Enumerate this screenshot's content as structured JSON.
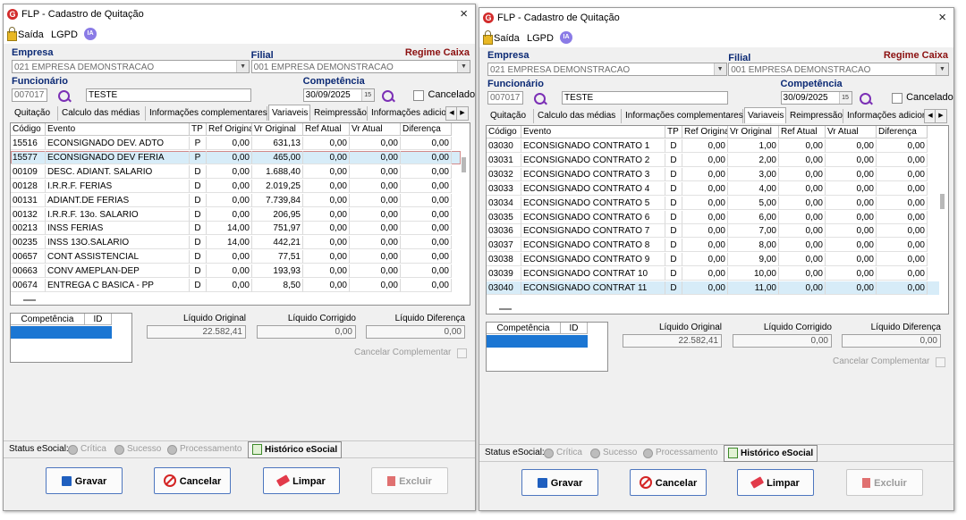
{
  "window": {
    "title": "FLP - Cadastro de Quitação",
    "close_glyph": "×",
    "logo_glyph": "G",
    "ia_label": "IA"
  },
  "menu": {
    "saida": "Saída",
    "lgpd": "LGPD"
  },
  "labels": {
    "empresa": "Empresa",
    "filial": "Filial",
    "regime": "Regime Caixa",
    "funcionario": "Funcionário",
    "competencia": "Competência",
    "cancelado": "Cancelado"
  },
  "tabs": [
    "Quitação",
    "Calculo das médias",
    "Informações complementares",
    "Variaveis",
    "Reimpressão",
    "Informações adicionais"
  ],
  "grid_headers": [
    "Código",
    "Evento",
    "TP",
    "Ref Original",
    "Vr Original",
    "Ref Atual",
    "Vr Atual",
    "Diferença"
  ],
  "comp_headers": [
    "Competência",
    "ID"
  ],
  "summary_labels": {
    "original": "Líquido Original",
    "corrigido": "Líquido Corrigido",
    "diferenca": "Líquido Diferença"
  },
  "cancelar_complementar": "Cancelar Complementar",
  "status": {
    "label": "Status eSocial:",
    "critica": "Crítica",
    "sucesso": "Sucesso",
    "processamento": "Processamento",
    "historico": "Histórico eSocial"
  },
  "buttons": {
    "gravar": "Gravar",
    "cancelar": "Cancelar",
    "limpar": "Limpar",
    "excluir": "Excluir"
  },
  "left": {
    "empresa": "021 EMPRESA DEMONSTRACAO",
    "filial": "001 EMPRESA DEMONSTRACAO",
    "funcionario_code": "007017",
    "funcionario_name": "TESTE",
    "competencia": "30/09/2025",
    "rows": [
      {
        "codigo": "15516",
        "evento": "ECONSIGNADO DEV. ADTO",
        "tp": "P",
        "ref_orig": "0,00",
        "vr_orig": "631,13",
        "ref_atual": "0,00",
        "vr_atual": "0,00",
        "dif": "0,00"
      },
      {
        "codigo": "15577",
        "evento": "ECONSIGNADO DEV FERIA",
        "tp": "P",
        "ref_orig": "0,00",
        "vr_orig": "465,00",
        "ref_atual": "0,00",
        "vr_atual": "0,00",
        "dif": "0,00"
      },
      {
        "codigo": "00109",
        "evento": "DESC. ADIANT. SALARIO",
        "tp": "D",
        "ref_orig": "0,00",
        "vr_orig": "1.688,40",
        "ref_atual": "0,00",
        "vr_atual": "0,00",
        "dif": "0,00"
      },
      {
        "codigo": "00128",
        "evento": "I.R.R.F. FERIAS",
        "tp": "D",
        "ref_orig": "0,00",
        "vr_orig": "2.019,25",
        "ref_atual": "0,00",
        "vr_atual": "0,00",
        "dif": "0,00"
      },
      {
        "codigo": "00131",
        "evento": "ADIANT.DE FERIAS",
        "tp": "D",
        "ref_orig": "0,00",
        "vr_orig": "7.739,84",
        "ref_atual": "0,00",
        "vr_atual": "0,00",
        "dif": "0,00"
      },
      {
        "codigo": "00132",
        "evento": "I.R.R.F. 13o. SALARIO",
        "tp": "D",
        "ref_orig": "0,00",
        "vr_orig": "206,95",
        "ref_atual": "0,00",
        "vr_atual": "0,00",
        "dif": "0,00"
      },
      {
        "codigo": "00213",
        "evento": "INSS FERIAS",
        "tp": "D",
        "ref_orig": "14,00",
        "vr_orig": "751,97",
        "ref_atual": "0,00",
        "vr_atual": "0,00",
        "dif": "0,00"
      },
      {
        "codigo": "00235",
        "evento": "INSS 13O.SALARIO",
        "tp": "D",
        "ref_orig": "14,00",
        "vr_orig": "442,21",
        "ref_atual": "0,00",
        "vr_atual": "0,00",
        "dif": "0,00"
      },
      {
        "codigo": "00657",
        "evento": "CONT ASSISTENCIAL",
        "tp": "D",
        "ref_orig": "0,00",
        "vr_orig": "77,51",
        "ref_atual": "0,00",
        "vr_atual": "0,00",
        "dif": "0,00"
      },
      {
        "codigo": "00663",
        "evento": "CONV AMEPLAN-DEP",
        "tp": "D",
        "ref_orig": "0,00",
        "vr_orig": "193,93",
        "ref_atual": "0,00",
        "vr_atual": "0,00",
        "dif": "0,00"
      },
      {
        "codigo": "00674",
        "evento": "ENTREGA C BASICA - PP",
        "tp": "D",
        "ref_orig": "0,00",
        "vr_orig": "8,50",
        "ref_atual": "0,00",
        "vr_atual": "0,00",
        "dif": "0,00"
      }
    ],
    "liquido_original": "22.582,41",
    "liquido_corrigido": "0,00",
    "liquido_diferenca": "0,00"
  },
  "right": {
    "empresa": "021 EMPRESA DEMONSTRACAO",
    "filial": "001 EMPRESA DEMONSTRACAO",
    "funcionario_code": "007017",
    "funcionario_name": "TESTE",
    "competencia": "30/09/2025",
    "rows": [
      {
        "codigo": "03030",
        "evento": "ECONSIGNADO CONTRATO 1",
        "tp": "D",
        "ref_orig": "0,00",
        "vr_orig": "1,00",
        "ref_atual": "0,00",
        "vr_atual": "0,00",
        "dif": "0,00"
      },
      {
        "codigo": "03031",
        "evento": "ECONSIGNADO CONTRATO 2",
        "tp": "D",
        "ref_orig": "0,00",
        "vr_orig": "2,00",
        "ref_atual": "0,00",
        "vr_atual": "0,00",
        "dif": "0,00"
      },
      {
        "codigo": "03032",
        "evento": "ECONSIGNADO CONTRATO 3",
        "tp": "D",
        "ref_orig": "0,00",
        "vr_orig": "3,00",
        "ref_atual": "0,00",
        "vr_atual": "0,00",
        "dif": "0,00"
      },
      {
        "codigo": "03033",
        "evento": "ECONSIGNADO CONTRATO 4",
        "tp": "D",
        "ref_orig": "0,00",
        "vr_orig": "4,00",
        "ref_atual": "0,00",
        "vr_atual": "0,00",
        "dif": "0,00"
      },
      {
        "codigo": "03034",
        "evento": "ECONSIGNADO CONTRATO 5",
        "tp": "D",
        "ref_orig": "0,00",
        "vr_orig": "5,00",
        "ref_atual": "0,00",
        "vr_atual": "0,00",
        "dif": "0,00"
      },
      {
        "codigo": "03035",
        "evento": "ECONSIGNADO CONTRATO 6",
        "tp": "D",
        "ref_orig": "0,00",
        "vr_orig": "6,00",
        "ref_atual": "0,00",
        "vr_atual": "0,00",
        "dif": "0,00"
      },
      {
        "codigo": "03036",
        "evento": "ECONSIGNADO CONTRATO 7",
        "tp": "D",
        "ref_orig": "0,00",
        "vr_orig": "7,00",
        "ref_atual": "0,00",
        "vr_atual": "0,00",
        "dif": "0,00"
      },
      {
        "codigo": "03037",
        "evento": "ECONSIGNADO CONTRATO 8",
        "tp": "D",
        "ref_orig": "0,00",
        "vr_orig": "8,00",
        "ref_atual": "0,00",
        "vr_atual": "0,00",
        "dif": "0,00"
      },
      {
        "codigo": "03038",
        "evento": "ECONSIGNADO CONTRATO 9",
        "tp": "D",
        "ref_orig": "0,00",
        "vr_orig": "9,00",
        "ref_atual": "0,00",
        "vr_atual": "0,00",
        "dif": "0,00"
      },
      {
        "codigo": "03039",
        "evento": "ECONSIGNADO CONTRAT 10",
        "tp": "D",
        "ref_orig": "0,00",
        "vr_orig": "10,00",
        "ref_atual": "0,00",
        "vr_atual": "0,00",
        "dif": "0,00"
      },
      {
        "codigo": "03040",
        "evento": "ECONSIGNADO CONTRAT 11",
        "tp": "D",
        "ref_orig": "0,00",
        "vr_orig": "11,00",
        "ref_atual": "0,00",
        "vr_atual": "0,00",
        "dif": "0,00"
      }
    ],
    "liquido_original": "22.582,41",
    "liquido_corrigido": "0,00",
    "liquido_diferenca": "0,00"
  },
  "colors": {
    "accent": "#0c2a75",
    "regime": "#8b1010",
    "selection": "#d7ecf8",
    "comp_selected": "#1b76d3"
  }
}
